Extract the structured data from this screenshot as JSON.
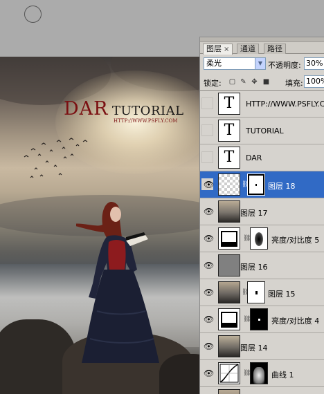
{
  "canvas": {
    "logo_big": "DAR",
    "logo_small": "TUTORIAL",
    "logo_url": "HTTP://WWW.PSFLY.COM"
  },
  "panel": {
    "tabs": [
      {
        "label": "图层",
        "active": true,
        "closable": true
      },
      {
        "label": "通道",
        "active": false
      },
      {
        "label": "路径",
        "active": false
      }
    ],
    "tab_close_glyph": "×",
    "blend_mode": "柔光",
    "opacity_label": "不透明度:",
    "opacity_value": "30%",
    "lock_label": "锁定:",
    "fill_label": "填充:",
    "fill_value": "100%",
    "lock_icons": [
      "lock-transparent-icon",
      "lock-paint-icon",
      "lock-move-icon",
      "lock-all-icon"
    ]
  },
  "layers": [
    {
      "name": "HTTP://WWW.PSFLY.COM",
      "type": "text",
      "visible": false,
      "selected": false
    },
    {
      "name": "TUTORIAL",
      "type": "text",
      "visible": false,
      "selected": false
    },
    {
      "name": "DAR",
      "type": "text",
      "visible": false,
      "selected": false
    },
    {
      "name": "图层 18",
      "type": "pixel-mask",
      "visible": true,
      "selected": true
    },
    {
      "name": "图层 17",
      "type": "pixel",
      "visible": true,
      "selected": false
    },
    {
      "name": "亮度/对比度 5",
      "type": "adjustment",
      "visible": true,
      "selected": false
    },
    {
      "name": "图层 16",
      "type": "gray",
      "visible": true,
      "selected": false
    },
    {
      "name": "图层 15",
      "type": "pixel-mask",
      "visible": true,
      "selected": false
    },
    {
      "name": "亮度/对比度 4",
      "type": "adjustment",
      "visible": true,
      "selected": false
    },
    {
      "name": "图层 14",
      "type": "pixel",
      "visible": true,
      "selected": false
    },
    {
      "name": "曲线 1",
      "type": "curves",
      "visible": true,
      "selected": false
    }
  ],
  "colors": {
    "selection": "#316ac5",
    "panel_bg": "#d6d3ce",
    "logo_red": "#7b1012"
  }
}
